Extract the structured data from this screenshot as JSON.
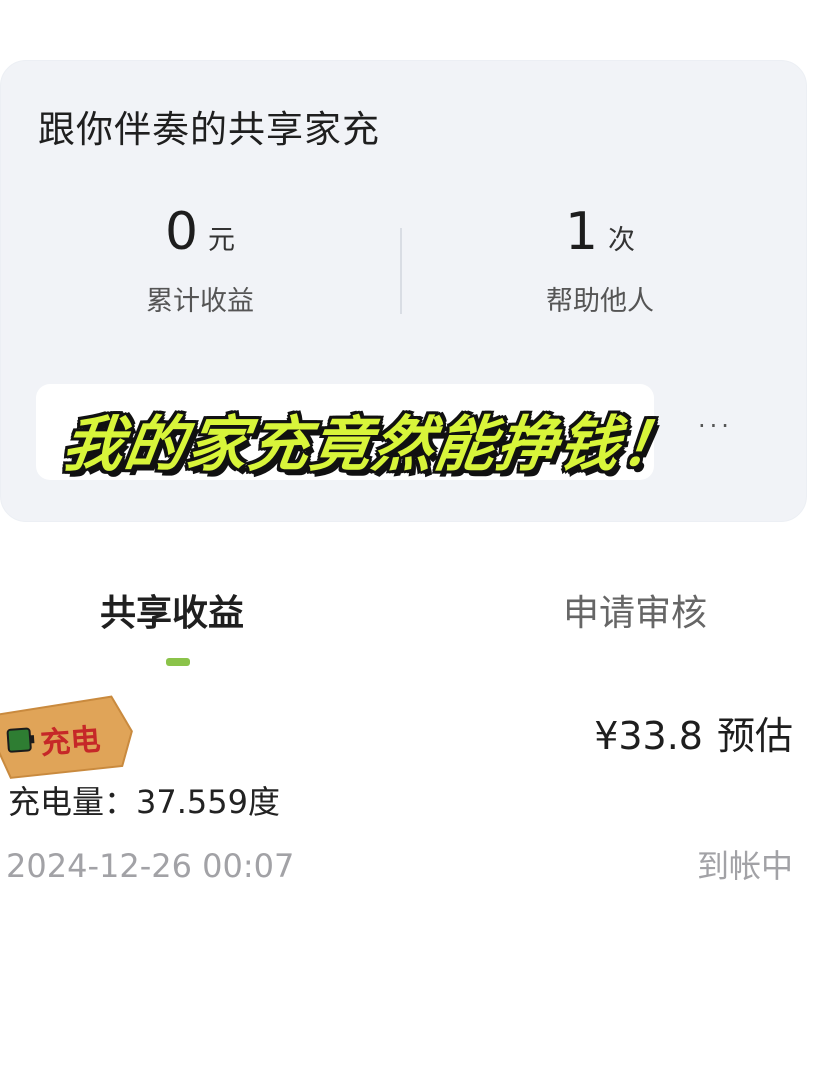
{
  "card": {
    "title": "跟你伴奏的共享家充",
    "stats": [
      {
        "value": "0",
        "unit": "元",
        "label": "累计收益"
      },
      {
        "value": "1",
        "unit": "次",
        "label": "帮助他人"
      }
    ],
    "more": "···"
  },
  "overlay": {
    "headline": "我的家充竟然能挣钱！"
  },
  "tabs": [
    {
      "label": "共享收益",
      "active": true
    },
    {
      "label": "申请审核",
      "active": false
    }
  ],
  "record": {
    "sticker_text": "充电",
    "amount": "¥33.8",
    "amount_suffix": "预估",
    "charge_label": "充电量：",
    "charge_value": "37.559度",
    "datetime": "2024-12-26 00:07",
    "status": "到帐中"
  },
  "colors": {
    "headline_fill": "#d8f53a",
    "tab_indicator": "#8bc34a",
    "sticker_bg": "#e0a458"
  }
}
